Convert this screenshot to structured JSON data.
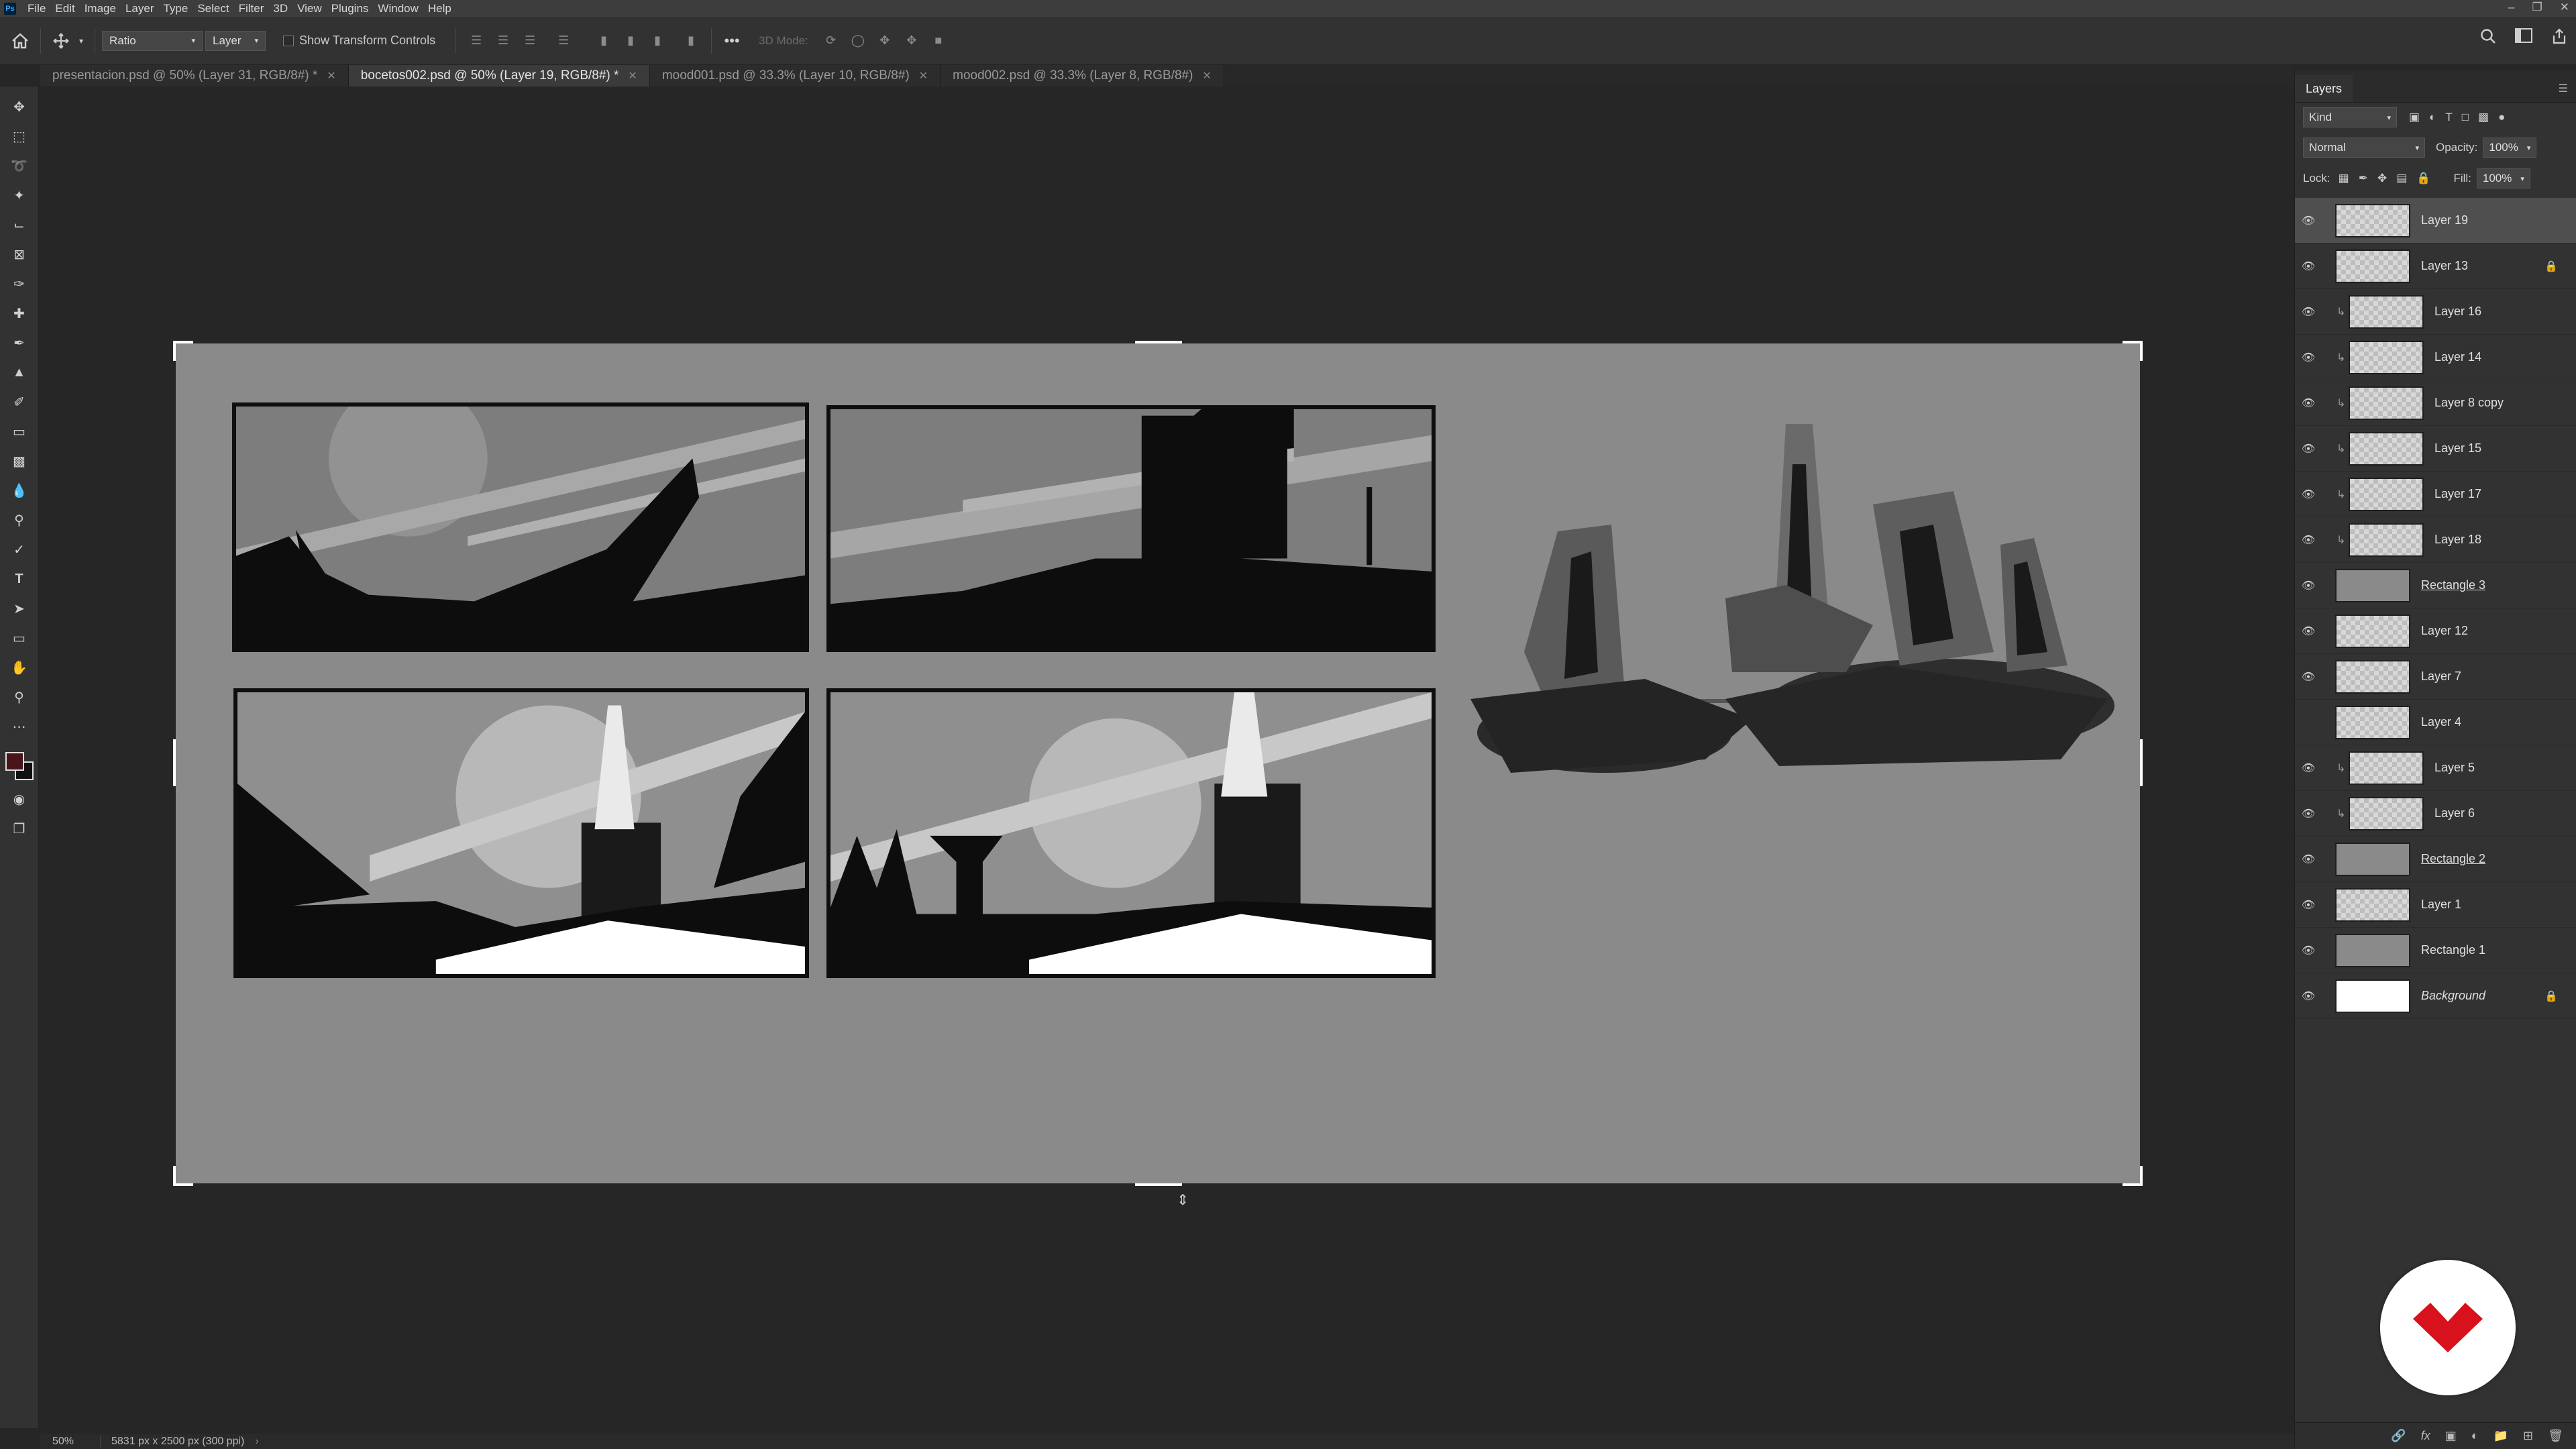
{
  "menu": {
    "items": [
      "File",
      "Edit",
      "Image",
      "Layer",
      "Type",
      "Select",
      "Filter",
      "3D",
      "View",
      "Plugins",
      "Window",
      "Help"
    ],
    "logo": "Ps"
  },
  "options": {
    "ratio": "Ratio",
    "layer": "Layer",
    "show_transform": "Show Transform Controls",
    "mode3d": "3D Mode:"
  },
  "tabs": [
    {
      "label": "presentacion.psd @ 50% (Layer 31, RGB/8#) *",
      "active": false
    },
    {
      "label": "bocetos002.psd @ 50% (Layer 19, RGB/8#) *",
      "active": true
    },
    {
      "label": "mood001.psd @ 33.3% (Layer 10, RGB/8#)",
      "active": false
    },
    {
      "label": "mood002.psd @ 33.3% (Layer 8, RGB/8#)",
      "active": false
    }
  ],
  "status": {
    "zoom": "50%",
    "doc": "5831 px x 2500 px (300 ppi)"
  },
  "panel": {
    "title": "Layers",
    "kind": "Kind",
    "blend": "Normal",
    "opacity_label": "Opacity:",
    "opacity": "100%",
    "lock_label": "Lock:",
    "fill_label": "Fill:",
    "fill": "100%"
  },
  "layers": [
    {
      "name": "Layer 19",
      "selected": true,
      "clipped": false,
      "visible": true,
      "locked": false,
      "style": ""
    },
    {
      "name": "Layer 13",
      "selected": false,
      "clipped": false,
      "visible": true,
      "locked": true,
      "style": ""
    },
    {
      "name": "Layer 16",
      "selected": false,
      "clipped": true,
      "visible": true,
      "locked": false,
      "style": ""
    },
    {
      "name": "Layer 14",
      "selected": false,
      "clipped": true,
      "visible": true,
      "locked": false,
      "style": ""
    },
    {
      "name": "Layer 8 copy",
      "selected": false,
      "clipped": true,
      "visible": true,
      "locked": false,
      "style": ""
    },
    {
      "name": "Layer 15",
      "selected": false,
      "clipped": true,
      "visible": true,
      "locked": false,
      "style": ""
    },
    {
      "name": "Layer 17",
      "selected": false,
      "clipped": true,
      "visible": true,
      "locked": false,
      "style": ""
    },
    {
      "name": "Layer 18",
      "selected": false,
      "clipped": true,
      "visible": true,
      "locked": false,
      "style": ""
    },
    {
      "name": "Rectangle 3",
      "selected": false,
      "clipped": false,
      "visible": true,
      "locked": false,
      "style": "underline"
    },
    {
      "name": "Layer 12",
      "selected": false,
      "clipped": false,
      "visible": true,
      "locked": false,
      "style": ""
    },
    {
      "name": "Layer 7",
      "selected": false,
      "clipped": false,
      "visible": true,
      "locked": false,
      "style": ""
    },
    {
      "name": "Layer 4",
      "selected": false,
      "clipped": false,
      "visible": false,
      "locked": false,
      "style": ""
    },
    {
      "name": "Layer 5",
      "selected": false,
      "clipped": true,
      "visible": true,
      "locked": false,
      "style": ""
    },
    {
      "name": "Layer 6",
      "selected": false,
      "clipped": true,
      "visible": true,
      "locked": false,
      "style": ""
    },
    {
      "name": "Rectangle 2",
      "selected": false,
      "clipped": false,
      "visible": true,
      "locked": false,
      "style": "underline"
    },
    {
      "name": "Layer 1",
      "selected": false,
      "clipped": false,
      "visible": true,
      "locked": false,
      "style": ""
    },
    {
      "name": "Rectangle 1",
      "selected": false,
      "clipped": false,
      "visible": true,
      "locked": false,
      "style": ""
    },
    {
      "name": "Background",
      "selected": false,
      "clipped": false,
      "visible": true,
      "locked": true,
      "style": "italic"
    }
  ],
  "colors": {
    "canvas": "#8a8a8a",
    "badge_red": "#d7121c",
    "foreground": "#4a1418"
  }
}
